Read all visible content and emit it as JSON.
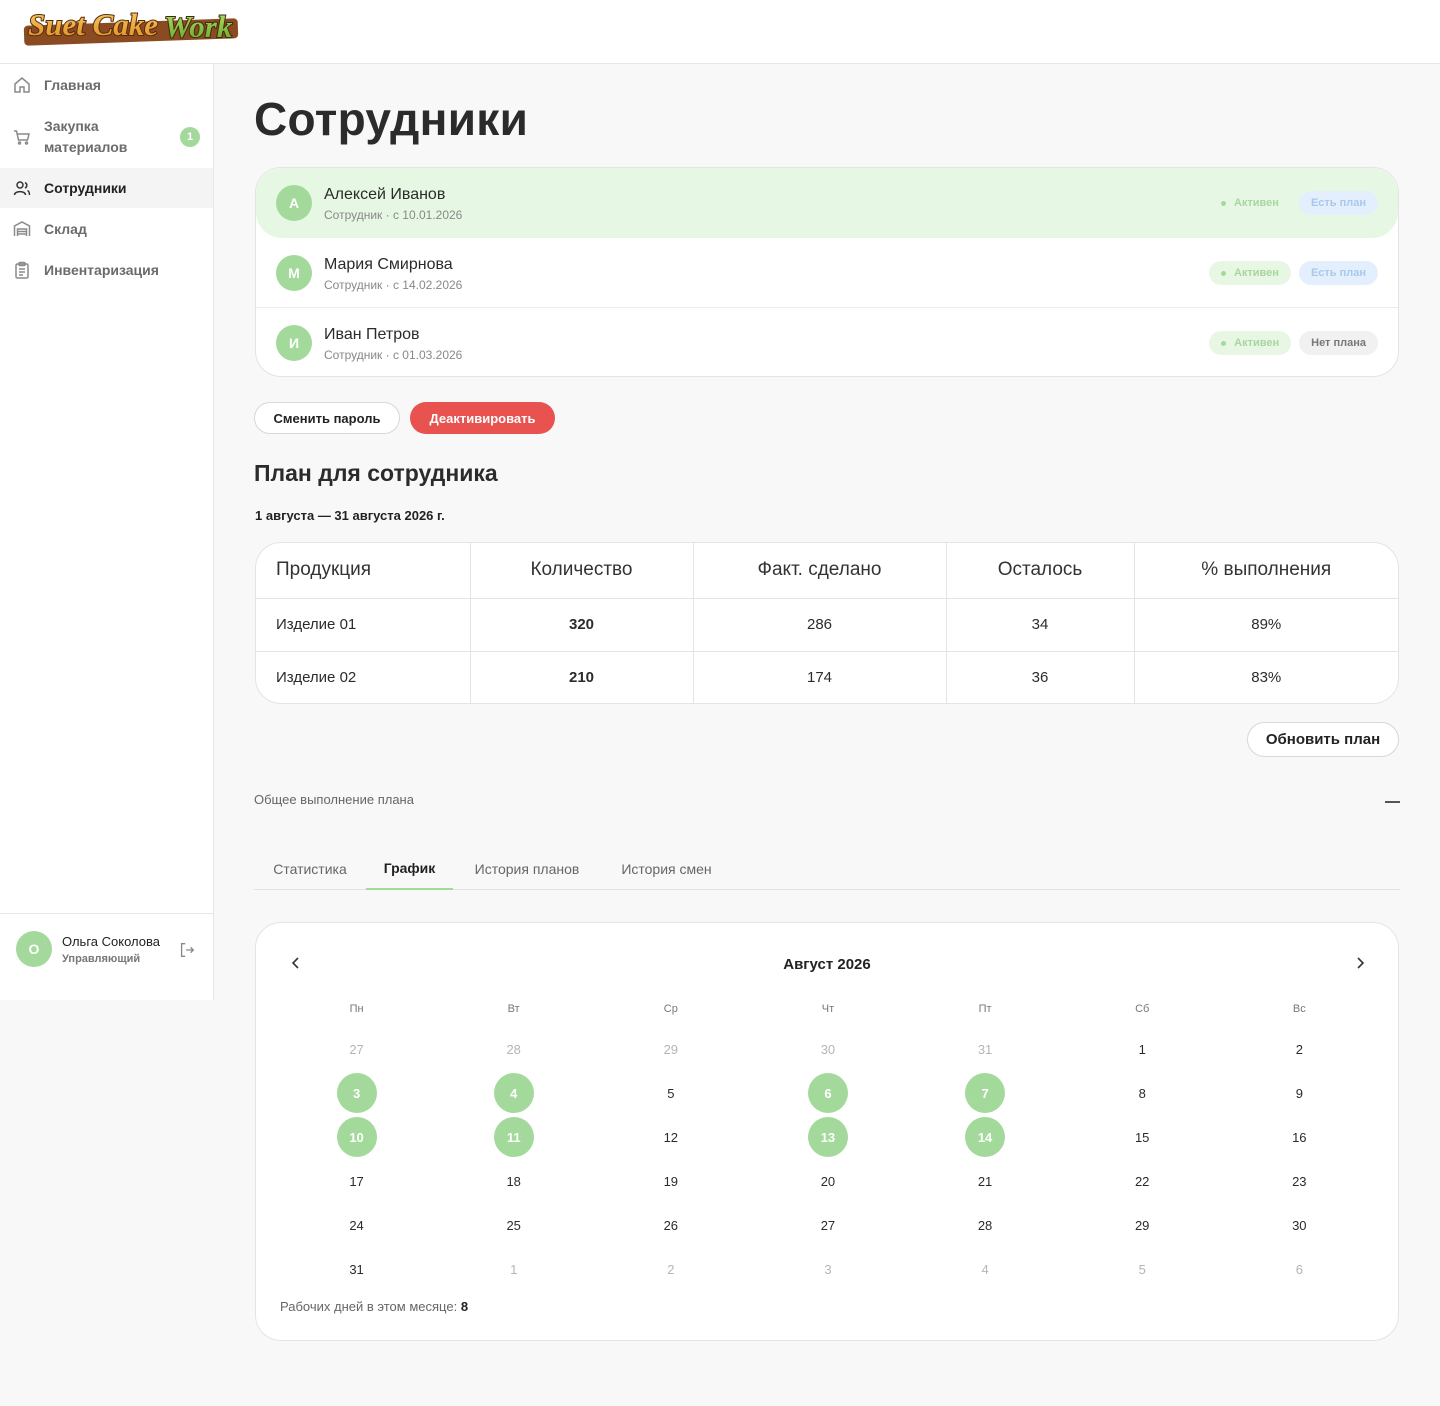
{
  "brand": {
    "logo_text": "Suet Cake Work",
    "accent": "#a3d99b",
    "danger": "#e8524f"
  },
  "sidebar": {
    "items": [
      {
        "label": "Главная",
        "icon": "home-icon",
        "active": false
      },
      {
        "label": "Закупка материалов",
        "icon": "cart-icon",
        "active": false,
        "badge": "1"
      },
      {
        "label": "Сотрудники",
        "icon": "users-icon",
        "active": true
      },
      {
        "label": "Склад",
        "icon": "warehouse-icon",
        "active": false
      },
      {
        "label": "Инвентаризация",
        "icon": "clipboard-icon",
        "active": false
      }
    ],
    "user": {
      "initial": "О",
      "name": "Ольга Соколова",
      "role": "Управляющий"
    }
  },
  "page": {
    "title": "Сотрудники"
  },
  "employees": [
    {
      "initial": "А",
      "name": "Алексей Иванов",
      "sub": "Сотрудник · с 10.01.2026",
      "status": "Активен",
      "plan": "Есть план",
      "has_plan": true,
      "selected": true
    },
    {
      "initial": "М",
      "name": "Мария Смирнова",
      "sub": "Сотрудник · с 14.02.2026",
      "status": "Активен",
      "plan": "Есть план",
      "has_plan": true,
      "selected": false
    },
    {
      "initial": "И",
      "name": "Иван Петров",
      "sub": "Сотрудник · с 01.03.2026",
      "status": "Активен",
      "plan": "Нет плана",
      "has_plan": false,
      "selected": false
    }
  ],
  "actions": {
    "change_password": "Сменить пароль",
    "deactivate": "Деактивировать"
  },
  "plan": {
    "title": "План для сотрудника",
    "period": "1 августа — 31 августа 2026 г.",
    "columns": [
      "Продукция",
      "Количество",
      "Факт. сделано",
      "Осталось",
      "% выполнения"
    ],
    "rows": [
      [
        "Изделие 01",
        "320",
        "286",
        "34",
        "89%"
      ],
      [
        "Изделие 02",
        "210",
        "174",
        "36",
        "83%"
      ]
    ],
    "update_button": "Обновить план"
  },
  "overall": {
    "title": "Общее выполнение плана"
  },
  "tabs": [
    {
      "label": "Статистика",
      "active": false
    },
    {
      "label": "График",
      "active": true
    },
    {
      "label": "История планов",
      "active": false
    },
    {
      "label": "История смен",
      "active": false
    }
  ],
  "calendar": {
    "title": "Август 2026",
    "weekdays": [
      "Пн",
      "Вт",
      "Ср",
      "Чт",
      "Пт",
      "Сб",
      "Вс"
    ],
    "weeks": [
      [
        {
          "d": "27",
          "m": true
        },
        {
          "d": "28",
          "m": true
        },
        {
          "d": "29",
          "m": true
        },
        {
          "d": "30",
          "m": true
        },
        {
          "d": "31",
          "m": true
        },
        {
          "d": "1"
        },
        {
          "d": "2"
        }
      ],
      [
        {
          "d": "3",
          "w": true
        },
        {
          "d": "4",
          "w": true
        },
        {
          "d": "5"
        },
        {
          "d": "6",
          "w": true
        },
        {
          "d": "7",
          "w": true
        },
        {
          "d": "8"
        },
        {
          "d": "9"
        }
      ],
      [
        {
          "d": "10",
          "w": true
        },
        {
          "d": "11",
          "w": true
        },
        {
          "d": "12"
        },
        {
          "d": "13",
          "w": true
        },
        {
          "d": "14",
          "w": true
        },
        {
          "d": "15"
        },
        {
          "d": "16"
        }
      ],
      [
        {
          "d": "17"
        },
        {
          "d": "18"
        },
        {
          "d": "19"
        },
        {
          "d": "20"
        },
        {
          "d": "21"
        },
        {
          "d": "22"
        },
        {
          "d": "23"
        }
      ],
      [
        {
          "d": "24"
        },
        {
          "d": "25"
        },
        {
          "d": "26"
        },
        {
          "d": "27"
        },
        {
          "d": "28"
        },
        {
          "d": "29"
        },
        {
          "d": "30"
        }
      ],
      [
        {
          "d": "31"
        },
        {
          "d": "1",
          "m": true
        },
        {
          "d": "2",
          "m": true
        },
        {
          "d": "3",
          "m": true
        },
        {
          "d": "4",
          "m": true
        },
        {
          "d": "5",
          "m": true
        },
        {
          "d": "6",
          "m": true
        }
      ]
    ],
    "footer_label": "Рабочих дней в этом месяце:",
    "footer_value": "8"
  }
}
